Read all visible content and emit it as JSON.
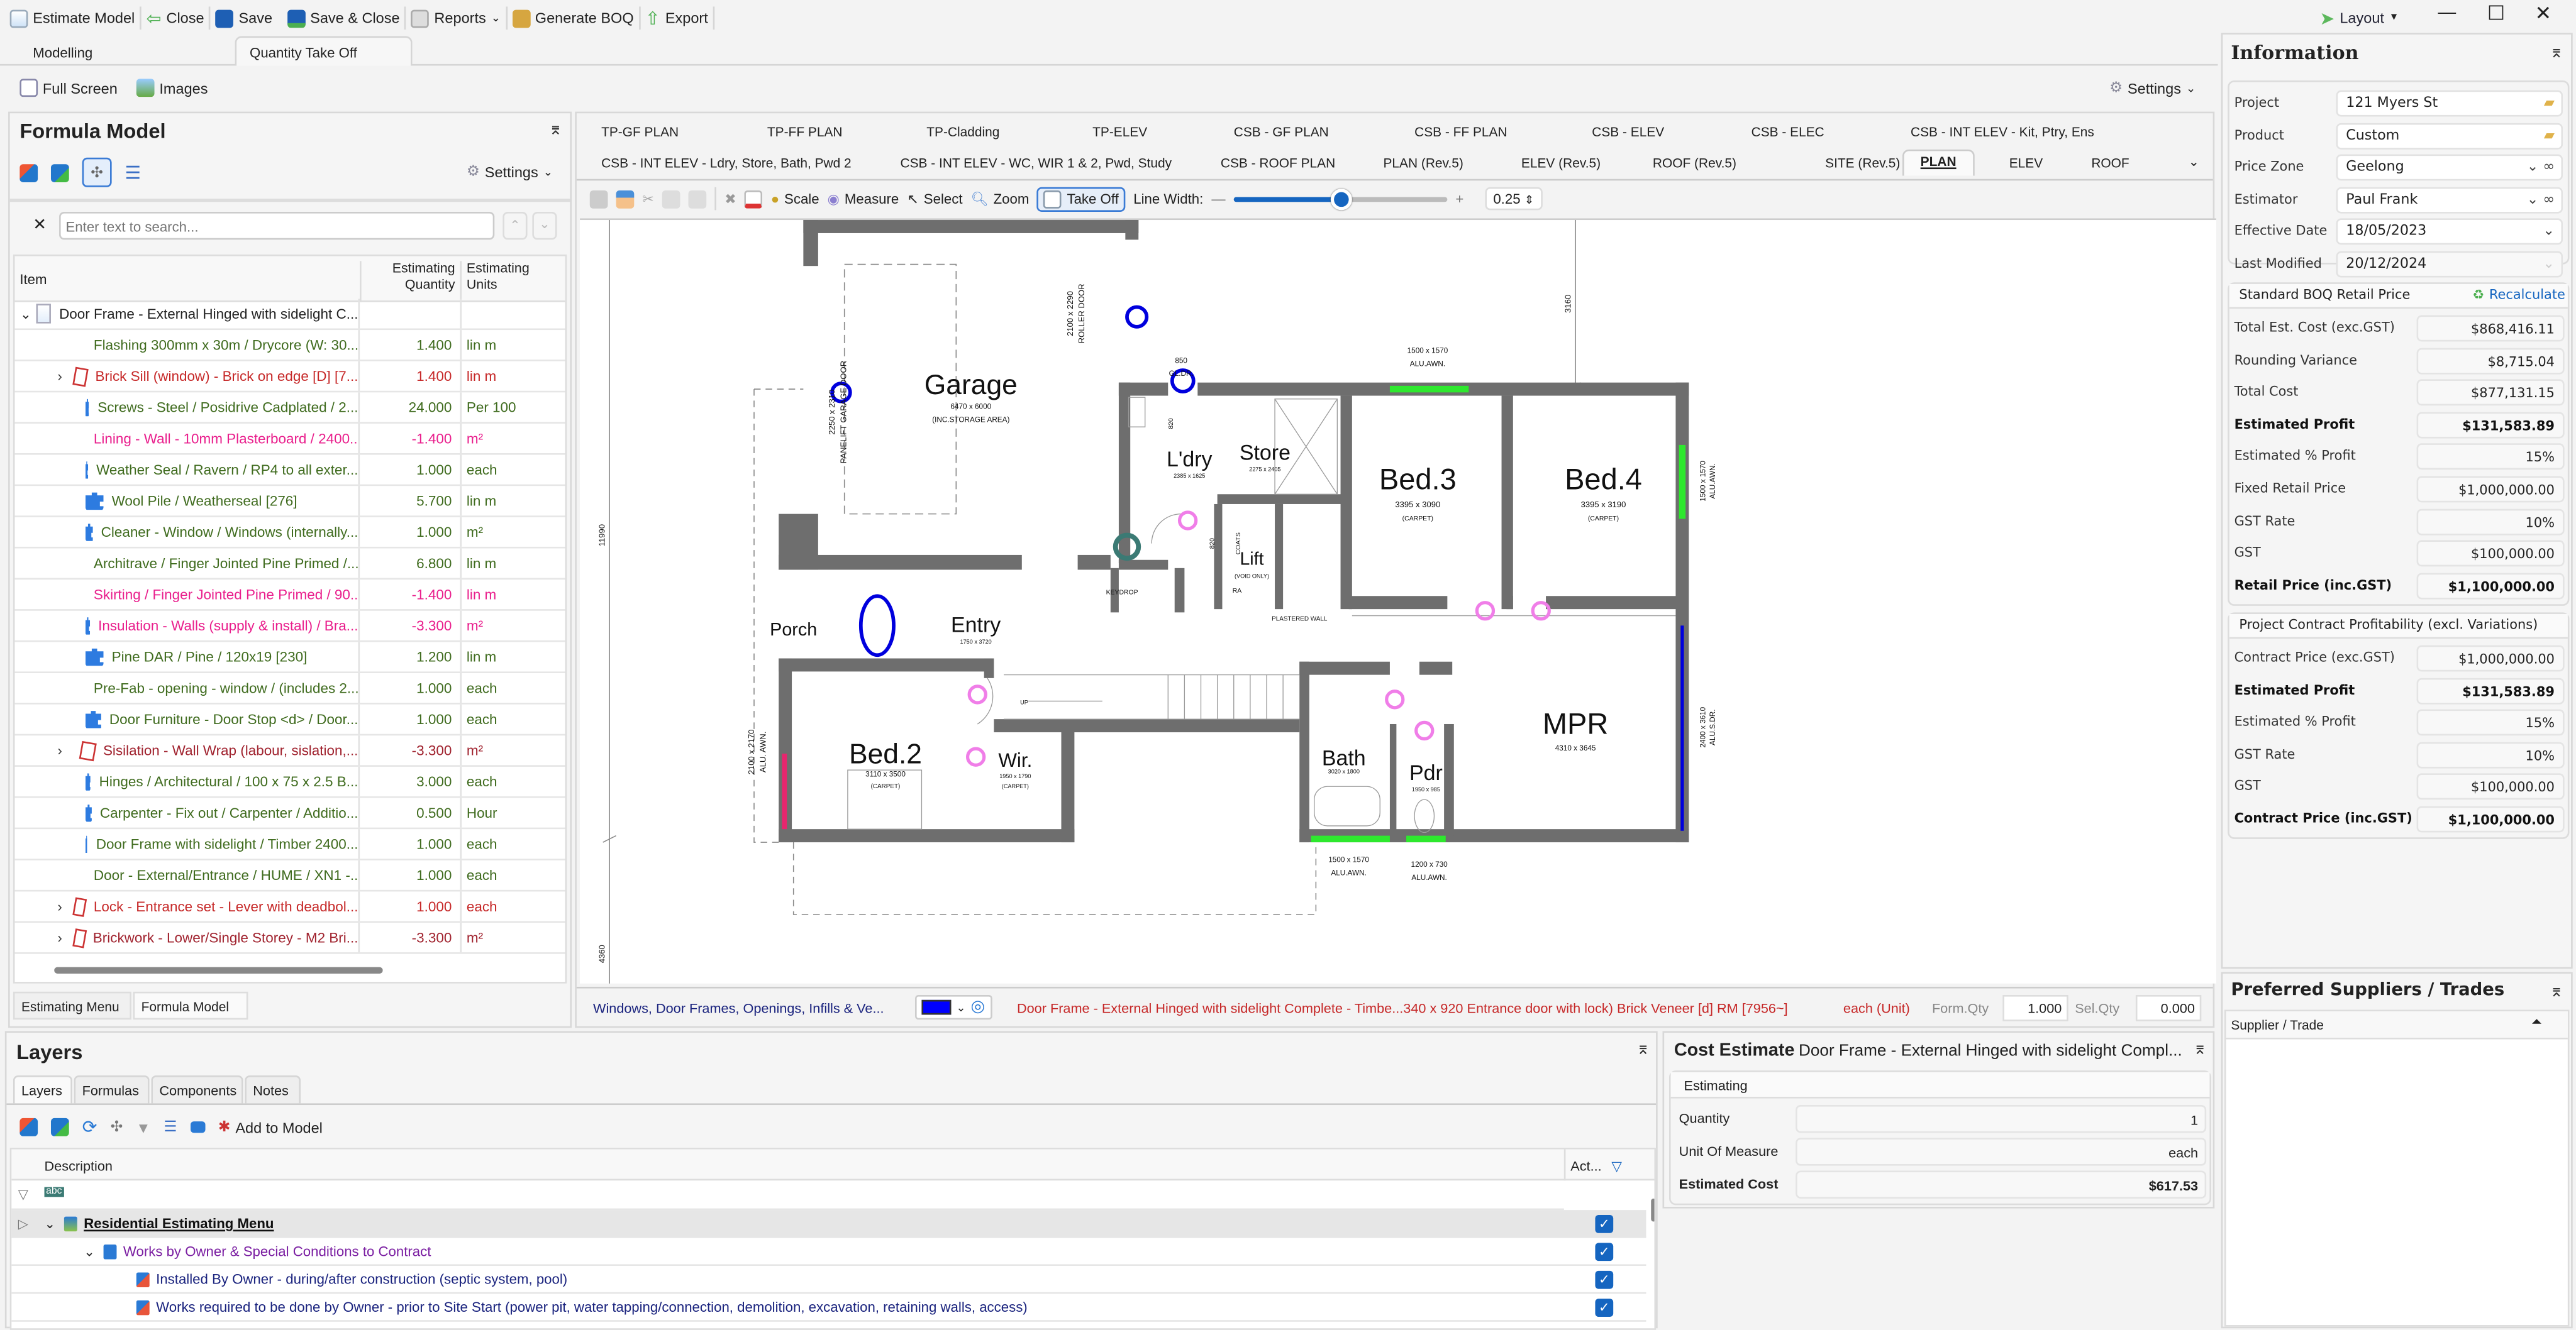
{
  "toolbar": {
    "estimate_model": "Estimate Model",
    "close": "Close",
    "save": "Save",
    "save_close": "Save & Close",
    "reports": "Reports",
    "generate_boq": "Generate BOQ",
    "export": "Export",
    "layout": "Layout"
  },
  "main_tabs": [
    "Modelling",
    "Quantity Take Off"
  ],
  "sub_toolbar": {
    "full_screen": "Full Screen",
    "images": "Images",
    "settings": "Settings"
  },
  "formula_model": {
    "title": "Formula Model",
    "settings": "Settings",
    "search_placeholder": "Enter text to search...",
    "columns": {
      "item": "Item",
      "qty": "Estimating Quantity",
      "units": "Estimating Units"
    },
    "root": "Door Frame - External Hinged with sidelight C...",
    "rows": [
      {
        "item": "Flashing 300mm x 30m / Drycore (W: 30...",
        "qty": "1.400",
        "unit": "lin m",
        "color": "#3f6b1e",
        "icon": "puzzle",
        "expand": false
      },
      {
        "item": "Brick Sill (window) - Brick on edge [D] [7...",
        "qty": "1.400",
        "unit": "lin m",
        "color": "#c62828",
        "icon": "assembly",
        "expand": true
      },
      {
        "item": "Screws - Steel / Posidrive Cadplated / 2...",
        "qty": "24.000",
        "unit": "Per 100",
        "color": "#3f6b1e",
        "icon": "puzzle",
        "expand": false
      },
      {
        "item": "Lining - Wall - 10mm Plasterboard / 2400...",
        "qty": "-1.400",
        "unit": "m²",
        "color": "#e91e8c",
        "icon": "puzzle",
        "expand": false
      },
      {
        "item": "Weather Seal / Ravern / RP4 to all exter...",
        "qty": "1.000",
        "unit": "each",
        "color": "#3f6b1e",
        "icon": "puzzle",
        "expand": false
      },
      {
        "item": "Wool Pile / Weatherseal [276]",
        "qty": "5.700",
        "unit": "lin m",
        "color": "#3f6b1e",
        "icon": "puzzle",
        "expand": false
      },
      {
        "item": "Cleaner - Window / Windows (internally...",
        "qty": "1.000",
        "unit": "m²",
        "color": "#3f6b1e",
        "icon": "puzzle",
        "expand": false
      },
      {
        "item": "Architrave / Finger Jointed Pine Primed /...",
        "qty": "6.800",
        "unit": "lin m",
        "color": "#3f6b1e",
        "icon": "puzzle",
        "expand": false
      },
      {
        "item": "Skirting / Finger Jointed Pine Primed / 90...",
        "qty": "-1.400",
        "unit": "lin m",
        "color": "#e91e8c",
        "icon": "puzzle",
        "expand": false
      },
      {
        "item": "Insulation - Walls (supply & install) / Bra...",
        "qty": "-3.300",
        "unit": "m²",
        "color": "#e91e8c",
        "icon": "puzzle",
        "expand": false
      },
      {
        "item": "Pine DAR  / Pine / 120x19 [230]",
        "qty": "1.200",
        "unit": "lin m",
        "color": "#3f6b1e",
        "icon": "puzzle",
        "expand": false
      },
      {
        "item": "Pre-Fab - opening - window / (includes 2...",
        "qty": "1.000",
        "unit": "each",
        "color": "#3f6b1e",
        "icon": "puzzle",
        "expand": false
      },
      {
        "item": "Door Furniture - Door Stop <d> / Door...",
        "qty": "1.000",
        "unit": "each",
        "color": "#3f6b1e",
        "icon": "puzzle",
        "expand": false
      },
      {
        "item": "Sisilation - Wall Wrap (labour, sislation,...",
        "qty": "-3.300",
        "unit": "m²",
        "color": "#a0222e",
        "icon": "assembly",
        "expand": true
      },
      {
        "item": "Hinges / Architectural / 100 x 75 x 2.5 B...",
        "qty": "3.000",
        "unit": "each",
        "color": "#3f6b1e",
        "icon": "puzzle",
        "expand": false
      },
      {
        "item": "Carpenter - Fix out / Carpenter / Additio...",
        "qty": "0.500",
        "unit": "Hour",
        "color": "#3f6b1e",
        "icon": "puzzle",
        "expand": false
      },
      {
        "item": "Door Frame with sidelight / Timber 2400...",
        "qty": "1.000",
        "unit": "each",
        "color": "#3f6b1e",
        "icon": "puzzle",
        "expand": false
      },
      {
        "item": "Door - External/Entrance / HUME / XN1 -...",
        "qty": "1.000",
        "unit": "each",
        "color": "#3f6b1e",
        "icon": "puzzle",
        "expand": false
      },
      {
        "item": "Lock - Entrance set - Lever with deadbol...",
        "qty": "1.000",
        "unit": "each",
        "color": "#c62828",
        "icon": "assembly",
        "expand": true
      },
      {
        "item": "Brickwork - Lower/Single Storey - M2 Bri...",
        "qty": "-3.300",
        "unit": "m²",
        "color": "#a0222e",
        "icon": "assembly",
        "expand": true
      }
    ],
    "bottom_tabs": [
      "Estimating Menu",
      "Formula Model"
    ]
  },
  "drawing": {
    "tabs_row1": [
      "TP-GF PLAN",
      "TP-FF PLAN",
      "TP-Cladding",
      "TP-ELEV",
      "CSB - GF PLAN",
      "CSB - FF PLAN",
      "CSB - ELEV",
      "CSB - ELEC",
      "CSB - INT ELEV - Kit, Ptry, Ens"
    ],
    "tabs_row2": [
      "CSB - INT ELEV - Ldry, Store, Bath, Pwd 2",
      "CSB - INT ELEV - WC, WIR 1 & 2, Pwd, Study",
      "CSB - ROOF PLAN",
      "PLAN  (Rev.5)",
      "ELEV (Rev.5)",
      "ROOF (Rev.5)",
      "SITE (Rev.5)",
      "PLAN",
      "ELEV",
      "ROOF"
    ],
    "tools": {
      "scale": "Scale",
      "measure": "Measure",
      "select": "Select",
      "zoom": "Zoom",
      "take_off": "Take Off",
      "line_width": "Line Width:",
      "line_width_value": "0.25"
    },
    "line_width_slider": 0.5,
    "status": {
      "category": "Windows, Door Frames, Openings, Infills & Ve...",
      "item": "Door Frame - External Hinged with sidelight Complete - Timbe...340 x 920 Entrance door with lock) Brick Veneer [d] RM [7956~]",
      "unit": "each (Unit)",
      "form_qty_label": "Form.Qty",
      "form_qty": "1.000",
      "sel_qty_label": "Sel.Qty",
      "sel_qty": "0.000",
      "color": "#0000ff"
    }
  },
  "plan": {
    "labels": [
      "Garage",
      "6470 x 6000",
      "(INC.STORAGE AREA)",
      "L'dry",
      "2385 x 1625",
      "Store",
      "2275 x 2405",
      "Bed.3",
      "3395 x 3090",
      "(CARPET)",
      "Bed.4",
      "3395 x 3190",
      "(CARPET)",
      "Lift",
      "(VOID ONLY)",
      "KEYDROP",
      "COATS",
      "RA",
      "PLASTERED WALL",
      "Porch",
      "Entry",
      "1750 x 3720",
      "Bed.2",
      "3110 x 3500",
      "(CARPET)",
      "Wir.",
      "1950 x 1790",
      "(CARPET)",
      "Bath",
      "3020 x 1800",
      "Pdr",
      "1950 x 985",
      "MPR",
      "4310 x 3645",
      "UP",
      "1500 x 1570",
      "ALU.AWN.",
      "1500 x 1570",
      "ALU.AWN.",
      "1200 x 730",
      "ALU.AWN.",
      "850",
      "GL.DR.",
      "2100 x 2290",
      "ROLLER DOOR",
      "2250 x 2310",
      "PANELIFT GARAGE DOOR",
      "1500 x 1570",
      "ALU.AWN.",
      "2400 x 3610",
      "ALU.S.DR.",
      "2100 x 2170",
      "ALU. AWN.",
      "11990",
      "3160",
      "4360",
      "820",
      "820"
    ]
  },
  "layers": {
    "title": "Layers",
    "tabs": [
      "Layers",
      "Formulas",
      "Components",
      "Notes"
    ],
    "add_to_model": "Add to Model",
    "columns": {
      "description": "Description",
      "active": "Act..."
    },
    "rows": [
      {
        "text": "Residential Estimating Menu",
        "color": "#111",
        "checked": true
      },
      {
        "text": "Works by Owner & Special Conditions to Contract",
        "color": "#7b1fa2",
        "checked": true
      },
      {
        "text": "Installed By Owner - during/after construction (septic system, pool)",
        "color": "#1a237e",
        "checked": true
      },
      {
        "text": "Works required to be done by Owner - prior to Site Start (power pit, water tapping/connection, demolition, excavation, retaining walls, access)",
        "color": "#1a237e",
        "checked": true
      }
    ]
  },
  "cost_estimate": {
    "title": "Cost Estimate",
    "subtitle": "Door Frame - External Hinged with sidelight Compl...",
    "group": "Estimating",
    "rows": [
      {
        "label": "Quantity",
        "value": "1"
      },
      {
        "label": "Unit Of Measure",
        "value": "each"
      },
      {
        "label": "Estimated Cost",
        "value": "$617.53"
      }
    ]
  },
  "information": {
    "title": "Information",
    "fields": [
      {
        "label": "Project",
        "value": "121 Myers St"
      },
      {
        "label": "Product",
        "value": "Custom"
      },
      {
        "label": "Price Zone",
        "value": "Geelong"
      },
      {
        "label": "Estimator",
        "value": "Paul Frank"
      },
      {
        "label": "Effective Date",
        "value": "18/05/2023"
      },
      {
        "label": "Last Modified",
        "value": "20/12/2024"
      }
    ],
    "boq": {
      "title": "Standard BOQ Retail Price",
      "recalculate": "Recalculate",
      "rows": [
        {
          "label": "Total Est. Cost (exc.GST)",
          "value": "$868,416.11",
          "bold": false
        },
        {
          "label": "Rounding Variance",
          "value": "$8,715.04",
          "bold": false
        },
        {
          "label": "Total Cost",
          "value": "$877,131.15",
          "bold": false
        },
        {
          "label": "Estimated Profit",
          "value": "$131,583.89",
          "bold": true
        },
        {
          "label": "Estimated % Profit",
          "value": "15%",
          "bold": false
        },
        {
          "label": "Fixed Retail Price",
          "value": "$1,000,000.00",
          "bold": false
        },
        {
          "label": "GST Rate",
          "value": "10%",
          "bold": false
        },
        {
          "label": "GST",
          "value": "$100,000.00",
          "bold": false
        },
        {
          "label": "Retail Price (inc.GST)",
          "value": "$1,100,000.00",
          "bold": true
        }
      ]
    },
    "contract": {
      "title": "Project Contract Profitability (excl. Variations)",
      "rows": [
        {
          "label": "Contract Price (exc.GST)",
          "value": "$1,000,000.00",
          "bold": false
        },
        {
          "label": "Estimated Profit",
          "value": "$131,583.89",
          "bold": true
        },
        {
          "label": "Estimated % Profit",
          "value": "15%",
          "bold": false
        },
        {
          "label": "GST Rate",
          "value": "10%",
          "bold": false
        },
        {
          "label": "GST",
          "value": "$100,000.00",
          "bold": false
        },
        {
          "label": "Contract Price (inc.GST)",
          "value": "$1,100,000.00",
          "bold": true
        }
      ]
    }
  },
  "suppliers": {
    "title": "Preferred Suppliers / Trades",
    "column": "Supplier / Trade"
  }
}
